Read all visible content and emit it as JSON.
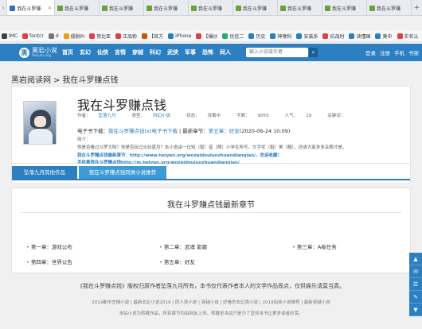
{
  "browser": {
    "tabs": [
      {
        "label": "我在斗罗赚",
        "active": true
      },
      {
        "label": "我在斗罗赚",
        "active": false
      },
      {
        "label": "我在斗罗赚",
        "active": false
      },
      {
        "label": "我在斗罗赚",
        "active": false
      },
      {
        "label": "我在斗罗赚",
        "active": false
      },
      {
        "label": "我在斗罗赚",
        "active": false
      },
      {
        "label": "我在斗罗赚",
        "active": false
      },
      {
        "label": "我在斗罗赚",
        "active": false
      },
      {
        "label": "我在斗罗赚",
        "active": false
      }
    ],
    "bookmarks": [
      {
        "label": "IMC",
        "color": "#444444"
      },
      {
        "label": "fontcr",
        "color": "#e04040"
      },
      {
        "label": "d",
        "color": "#777777"
      },
      {
        "label": "摆脱PI",
        "color": "#f39c12"
      },
      {
        "label": "努比亚",
        "color": "#e04040"
      },
      {
        "label": "正品粉",
        "color": "#e04040"
      },
      {
        "label": "【官方",
        "color": "#d35400"
      },
      {
        "label": "iPhone",
        "color": "#2c7fc1"
      },
      {
        "label": "【爆炒",
        "color": "#e04040"
      },
      {
        "label": "优信二",
        "color": "#27ae60"
      },
      {
        "label": "历史",
        "color": "#2c7fc1"
      },
      {
        "label": "神嗲科",
        "color": "#2c7fc1"
      },
      {
        "label": "安装系",
        "color": "#2c7fc1"
      },
      {
        "label": "抗战时",
        "color": "#e04040"
      },
      {
        "label": "读懂国",
        "color": "#2c7fc1"
      },
      {
        "label": "莫中",
        "color": "#2c7fc1"
      },
      {
        "label": "实名认",
        "color": "#e04040"
      }
    ]
  },
  "site": {
    "logo_text": "黑岩小说",
    "logo_sub": "heiyan.org",
    "logo_mark": "黑",
    "nav": [
      "首页",
      "玄幻",
      "仙侠",
      "言情",
      "穿越",
      "科幻",
      "武侠",
      "军事",
      "恐怖",
      "同人"
    ],
    "search_placeholder": "输入小说或作者",
    "search_icon": "search-icon",
    "user_nav": [
      "登录",
      "注册",
      "手机",
      "书架"
    ]
  },
  "breadcrumb": {
    "home": "黑岩阅读网",
    "separator": ">",
    "current": "我在斗罗赚点钱"
  },
  "book": {
    "title": "我在斗罗赚点钱",
    "meta": {
      "author_label": "作者：",
      "author": "坠落九月",
      "type_label": "类型：",
      "type": "科幻小说",
      "status_label": "状态：",
      "status": "连载中",
      "words_label": "字数：",
      "words": "9055",
      "popularity_label": "人气：",
      "popularity": "19",
      "keywords_label": "关键词："
    },
    "download": {
      "label": "电子书下载：",
      "link": "我在斗罗赚点钱txt电子书下载",
      "latest_label": "最新章节：",
      "latest": "第五章：好友",
      "date": "(2020-06-24 10:09)"
    },
    "intro_label": "简介：",
    "intro": "你是否看过斗罗大陆？你是否玩过炎玩蓝月？本小说由一位知（智）音（障）小学生所写，文字优（稻）美（糙），还请大家多多关照才是。",
    "link_desktop": "我在斗罗赚点钱最新章节：http://www.heiyan.org/wozaidouluozhuandianqian/，欢迎收藏！",
    "link_mobile": "手机看我在斗罗赚点钱http://m.heiyan.org/wozaidouluozhuandianqian/"
  },
  "tabs": {
    "author_works": "坠落九月其他作品",
    "similar": "我在斗罗赚点钱同类小说推荐"
  },
  "chapters": {
    "heading": "我在斗罗赚点钱最新章节",
    "items": [
      "第一章：游戏公布",
      "第二章：武魂 紫霜",
      "第三章：A级任务",
      "第四章：世界公告",
      "第五章：好友"
    ]
  },
  "footer": {
    "copyright": "《我在斗罗赚点钱》版权归原作者坠落九月所有，本书仅代表作者本人的文学作品观点，仅供娱乐请莫当真。",
    "links": "2019都市言情小说 | 最新玄幻小说2019 | 同人类小说 | 穿越小说 | 好看的玄幻类小说 | 2019仙侠小说推荐 | 最新穿越小说",
    "notice": "本站小说为转载作品，所有章节均由网友上传，转载至本站只是为了宣传本书让更多读者欣赏。"
  },
  "sidebar": [
    "▲",
    "✉",
    "☰",
    "✎",
    "▼"
  ]
}
